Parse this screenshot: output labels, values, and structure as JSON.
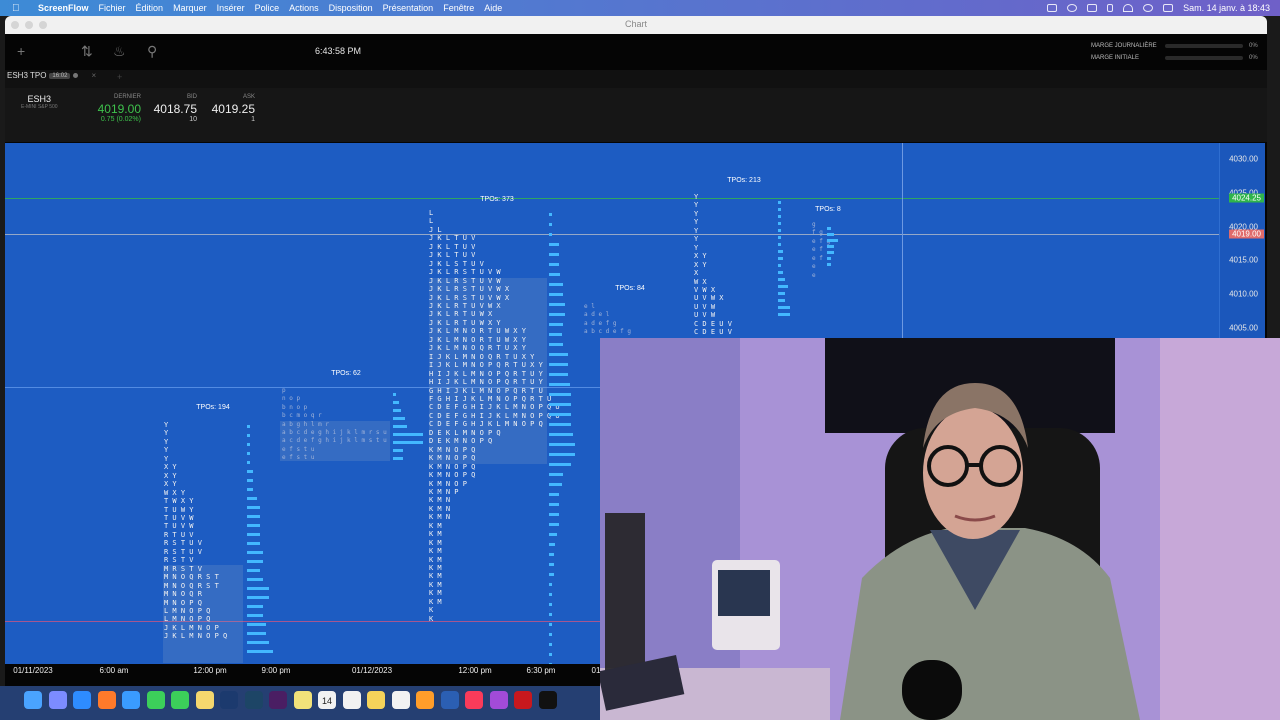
{
  "menubar": {
    "app": "ScreenFlow",
    "items": [
      "Fichier",
      "Édition",
      "Marquer",
      "Insérer",
      "Police",
      "Actions",
      "Disposition",
      "Présentation",
      "Fenêtre",
      "Aide"
    ],
    "clock": "Sam. 14 janv. à 18:43"
  },
  "window": {
    "title": "Chart"
  },
  "toolbar": {
    "time": "6:43:58 PM"
  },
  "margins": {
    "daily_label": "MARGE JOURNALIÈRE",
    "daily_value": "0%",
    "initial_label": "MARGE INITIALE",
    "initial_value": "0%"
  },
  "tab": {
    "label": "ESH3 TPO",
    "badge": "16:02"
  },
  "quote": {
    "symbol": "ESH3",
    "description": "E-MINI S&P 500",
    "last_label": "DERNIER",
    "last": "4019.00",
    "change": "0.75 (0.02%)",
    "bid_label": "BID",
    "bid": "4018.75",
    "bid_size": "10",
    "ask_label": "ASK",
    "ask": "4019.25",
    "ask_size": "1"
  },
  "chart_data": {
    "type": "tpo_profile",
    "y_axis": {
      "ticks": [
        "4030.00",
        "4025.00",
        "4020.00",
        "4015.00",
        "4010.00",
        "4005.00"
      ],
      "markers": {
        "ask": "4024.25",
        "last": "4019.00"
      }
    },
    "x_axis": {
      "ticks": [
        "01/11/2023",
        "6:00 am",
        "12:00 pm",
        "9:00 pm",
        "01/12/2023",
        "12:00 pm",
        "6:30 pm",
        "01"
      ]
    },
    "profiles": [
      {
        "label": "TPOs: 194"
      },
      {
        "label": "TPOs: 62"
      },
      {
        "label": "TPOs: 373"
      },
      {
        "label": "TPOs: 84"
      },
      {
        "label": "TPOs: 213"
      },
      {
        "label": "TPOs: 8"
      }
    ],
    "p1_rows": [
      "Y",
      "Y",
      "Y",
      "Y",
      "Y",
      "X Y",
      "X Y",
      "X Y",
      "W X Y",
      "T W X Y",
      "T U W Y",
      "T U V W",
      "T U V W",
      "R T U V",
      "R S T U V",
      "R S T U V",
      "R S T V",
      "M R S T V",
      "M N O Q R S T",
      "M N O Q R S T",
      "M N O Q R",
      "M N O P Q",
      "L M N O P Q",
      "L M N O P Q",
      "J K L M N O P",
      "J K L M N O P Q"
    ],
    "p3_rows": [
      "L",
      "L",
      "J L",
      "J K L T U V",
      "J K L T U V",
      "J K L T U V",
      "J K L S T U V",
      "J K L R S T U V W",
      "J K L R S T U V W",
      "J K L R S T U V W X",
      "J K L R S T U V W X",
      "J K L R T U V W X",
      "J K L R T U W X",
      "J K L R T U W X Y",
      "J K L M N O R T U W X Y",
      "J K L M N O R T U W X Y",
      "J K L M N O Q R T U X Y",
      "I J K L M N O Q R T U X Y",
      "I J K L M N O P Q R T U X Y",
      "H I J K L M N O P Q R T U Y",
      "H I J K L M N O P Q R T U Y",
      "G H I J K L M N O P Q R T U",
      "F G H I J K L M N O P Q R T U",
      "C D E F G H I J K L M N O P Q U",
      "C D E F G H I J K L M N O P Q U",
      "C D E F G H J K L M N O P Q",
      "D E K L M N O P Q",
      "D E K M N O P Q",
      "K M N O P Q",
      "K M N O P Q",
      "K M N O P Q",
      "K M N O P Q",
      "K M N O P",
      "K M N P",
      "K M N",
      "K M N",
      "K M N",
      "K M",
      "K M",
      "K M",
      "K M",
      "K M",
      "K M",
      "K M",
      "K M",
      "K M",
      "K M",
      "K",
      "K"
    ],
    "p2_rows": [
      "p",
      "n o p",
      "b n o p",
      "b c m o q r",
      "a b g h l m r",
      "a b c d e g h i j k l m r s u",
      "a c d e f g h i j k l m s t u",
      "e f s t u",
      "e f s t u"
    ],
    "p4_rows": [
      "e l",
      "a d e l",
      "a d e f g",
      "a b c d e f g"
    ],
    "p5_rows": [
      "Y",
      "Y",
      "Y",
      "Y",
      "Y",
      "Y",
      "Y",
      "X Y",
      "X Y",
      "X",
      "W X",
      "V W X",
      "U V W X",
      "U V W",
      "U V W",
      "C D E U V",
      "C D E U V"
    ],
    "p6_rows": [
      "g",
      "f g",
      "e f g",
      "e f",
      "e f",
      "e",
      "e"
    ]
  },
  "dock": {
    "icons": [
      "finder-icon",
      "launchpad-icon",
      "safari-icon",
      "firefox-icon",
      "mail-icon",
      "messages-icon",
      "facetime-icon",
      "photos-icon",
      "ps-icon",
      "lr-icon",
      "dw-icon",
      "stickies-icon",
      "calendar-icon",
      "reminders-icon",
      "notes-icon",
      "freeform-icon",
      "pages-icon",
      "word-icon",
      "music-icon",
      "podcasts-icon",
      "filezilla-icon",
      "tv-icon"
    ],
    "calendar_day": "14"
  }
}
